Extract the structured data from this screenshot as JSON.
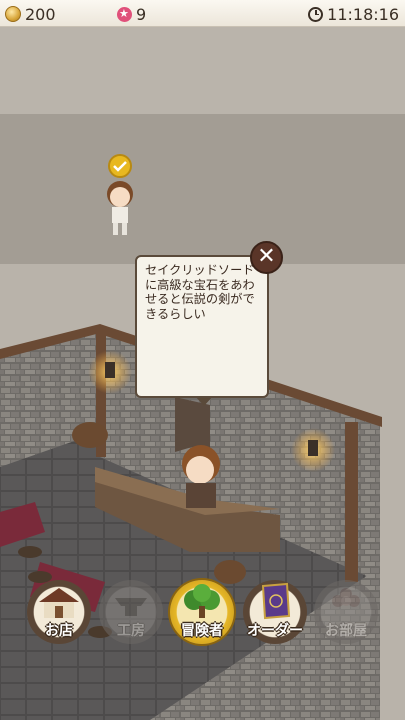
{
  "status_bar": {
    "coins": "200",
    "gems": "9",
    "time": "11:18:16"
  },
  "bubble": {
    "text": "セイクリッドソードに高級な宝石をあわせると伝説の剣ができるらしい",
    "close_icon": "close-icon"
  },
  "menu": {
    "shop_label": "お店",
    "workshop_label": "工房",
    "adventurer_label": "冒険者",
    "order_label": "オーダー",
    "room_label": "お部屋"
  },
  "colors": {
    "wall_top": "#bdb7ae",
    "back_wall": "#a39d94",
    "floor": "#514f4f",
    "close_button": "#5a3528",
    "active_ring": "#e6b728"
  }
}
